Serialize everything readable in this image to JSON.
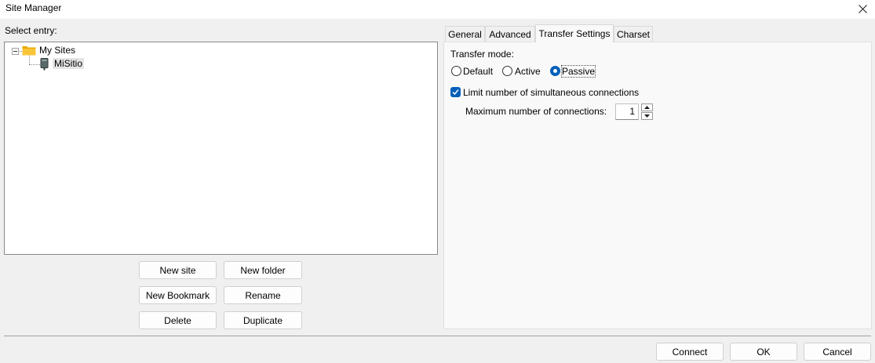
{
  "window": {
    "title": "Site Manager",
    "close_icon": "close-icon"
  },
  "tree": {
    "label": "Select entry:",
    "root": {
      "label": "My Sites",
      "icon": "folder-icon",
      "expander": "collapse-icon"
    },
    "children": [
      {
        "label": "MiSitio",
        "icon": "server-icon",
        "selected": true
      }
    ]
  },
  "buttons": {
    "new_site": "New site",
    "new_folder": "New folder",
    "new_bookmark": "New Bookmark",
    "rename": "Rename",
    "delete": "Delete",
    "duplicate": "Duplicate"
  },
  "tabs": [
    {
      "label": "General"
    },
    {
      "label": "Advanced"
    },
    {
      "label": "Transfer Settings",
      "active": true
    },
    {
      "label": "Charset"
    }
  ],
  "transfer": {
    "mode_label": "Transfer mode:",
    "modes": [
      {
        "label": "Default",
        "checked": false
      },
      {
        "label": "Active",
        "checked": false
      },
      {
        "label": "Passive",
        "checked": true
      }
    ],
    "limit_label": "Limit number of simultaneous connections",
    "limit_checked": true,
    "max_label": "Maximum number of connections:",
    "max_value": "1"
  },
  "footer": {
    "connect": "Connect",
    "ok": "OK",
    "cancel": "Cancel"
  },
  "colors": {
    "accent": "#005fb8",
    "folder": "#f8c43a"
  }
}
